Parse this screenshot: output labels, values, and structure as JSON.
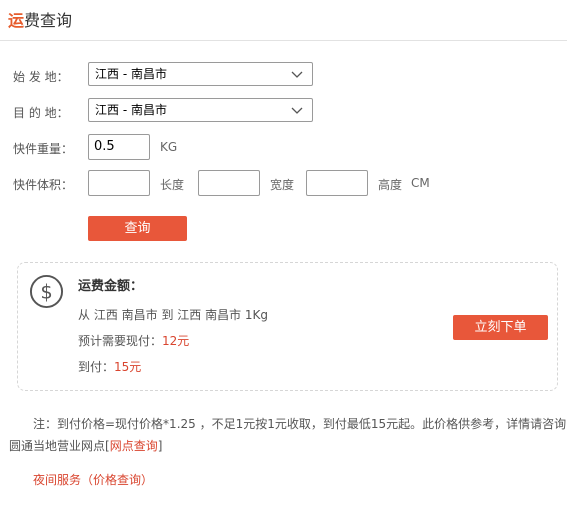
{
  "header": {
    "title_accent": "运",
    "title_rest": "费查询"
  },
  "form": {
    "origin": {
      "label": "始 发 地：",
      "value": "江西 - 南昌市"
    },
    "destination": {
      "label": "目 的 地：",
      "value": "江西 - 南昌市"
    },
    "weight": {
      "label": "快件重量：",
      "value": "0.5",
      "unit": "KG"
    },
    "volume": {
      "label": "快件体积：",
      "length_unit": "长度",
      "width_unit": "宽度",
      "height_unit": "高度",
      "cm_unit": "CM"
    },
    "query_button": "查询"
  },
  "result": {
    "title": "运费金额：",
    "route": "从 江西 南昌市 到 江西 南昌市 1Kg",
    "cash_label": "预计需要现付：",
    "cash_value": "12元",
    "cod_label": "到付：",
    "cod_value": "15元",
    "order_button": "立刻下单"
  },
  "note": {
    "text": "注：到付价格=现付价格*1.25 ，不足1元按1元收取，到付最低15元起。此价格供参考，详情请咨询圆通当地营业网点",
    "bracket_open": "[",
    "link": "网点查询",
    "bracket_close": "]"
  },
  "night_service": "夜间服务（价格查询）",
  "colors": {
    "accent": "#e8573a",
    "highlight": "#d9452f"
  }
}
